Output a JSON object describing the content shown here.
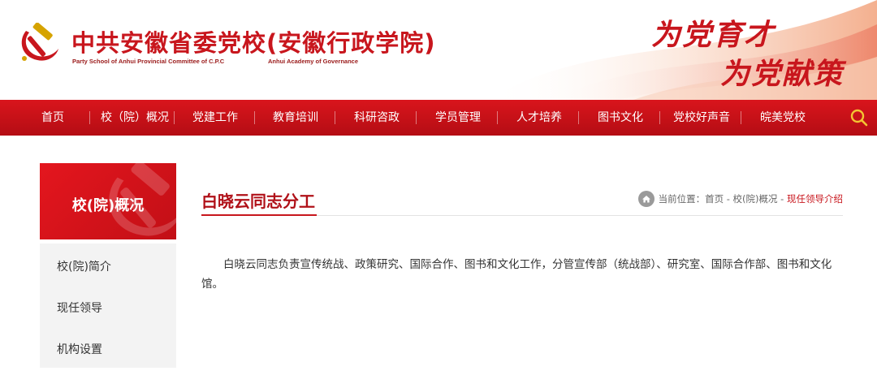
{
  "header": {
    "title_cn": "中共安徽省委党校(安徽行政学院)",
    "title_en_left": "Party School of Anhui Provincial Committee of C.P.C",
    "title_en_right": "Anhui Academy of Governance",
    "slogan_line1": "为党育才",
    "slogan_line2": "为党献策",
    "emblem_icon": "hammer-sickle-icon"
  },
  "nav": {
    "items": [
      {
        "label": "首页"
      },
      {
        "label": "校（院）概况"
      },
      {
        "label": "党建工作"
      },
      {
        "label": "教育培训"
      },
      {
        "label": "科研咨政"
      },
      {
        "label": "学员管理"
      },
      {
        "label": "人才培养"
      },
      {
        "label": "图书文化"
      },
      {
        "label": "党校好声音"
      },
      {
        "label": "皖美党校"
      }
    ],
    "search_icon": "search-icon"
  },
  "sidebar": {
    "title": "校(院)概况",
    "items": [
      {
        "label": "校(院)简介"
      },
      {
        "label": "现任领导"
      },
      {
        "label": "机构设置"
      }
    ]
  },
  "main": {
    "title": "白晓云同志分工",
    "breadcrumb": {
      "prefix": "当前位置：",
      "home": "首页",
      "sep": " - ",
      "section": "校(院)概况",
      "current": "现任领导介绍"
    },
    "content": "白晓云同志负责宣传统战、政策研究、国际合作、图书和文化工作，分管宣传部（统战部）、研究室、国际合作部、图书和文化馆。"
  },
  "colors": {
    "brand_red": "#c8161d",
    "nav_red": "#d9151c",
    "sidebar_bg": "#f3f3f3"
  }
}
